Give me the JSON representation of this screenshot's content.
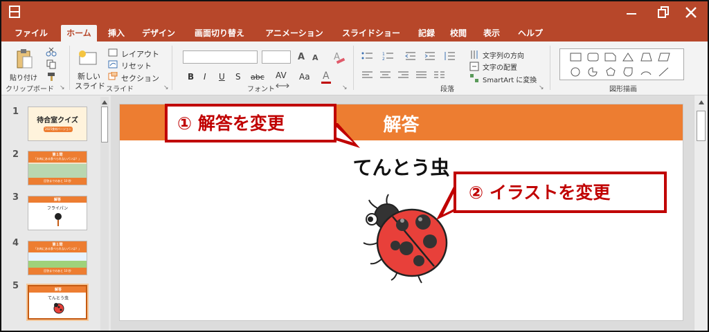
{
  "tabs": [
    "ファイル",
    "ホーム",
    "挿入",
    "デザイン",
    "画面切り替え",
    "アニメーション",
    "スライドショー",
    "記録",
    "校閲",
    "表示",
    "ヘルプ"
  ],
  "active_tab": "ホーム",
  "ribbon": {
    "clipboard": {
      "paste": "貼り付け",
      "group": "クリップボード"
    },
    "slides": {
      "new_slide_1": "新しい",
      "new_slide_2": "スライド",
      "layout": "レイアウト",
      "reset": "リセット",
      "section": "セクション",
      "group": "スライド"
    },
    "font": {
      "group": "フォント",
      "grow": "A",
      "shrink": "A",
      "bold": "B",
      "italic": "I",
      "underline": "U",
      "shadow": "S",
      "strike": "abc",
      "spacing": "AV",
      "case": "Aa",
      "color": "A"
    },
    "paragraph": {
      "group": "段落",
      "text_direction": "文字列の方向",
      "align_text": "文字の配置",
      "smartart": "SmartArt に変換"
    },
    "drawing": {
      "group": "図形描画"
    }
  },
  "thumbnails": [
    {
      "num": "1",
      "title": "待合室クイズ",
      "sub": "2025食材バージョン"
    },
    {
      "num": "2",
      "title": "第１問",
      "sub": "「お肉にある食べられないパンは？」",
      "footer": "回答までのあと 10 秒"
    },
    {
      "num": "3",
      "title": "解答",
      "sub": "フライパン"
    },
    {
      "num": "4",
      "title": "第１問",
      "sub": "「お肉にある食べられないパンは？」",
      "footer": "回答までのあと 10 秒"
    },
    {
      "num": "5",
      "title": "解答",
      "sub": "てんとう虫"
    }
  ],
  "slide": {
    "header": "解答",
    "answer": "てんとう虫"
  },
  "callouts": {
    "one": "① 解答を変更",
    "two": "② イラストを変更"
  },
  "colors": {
    "accent": "#b7472a",
    "slide_orange": "#ed7d31",
    "callout_red": "#c00000"
  }
}
